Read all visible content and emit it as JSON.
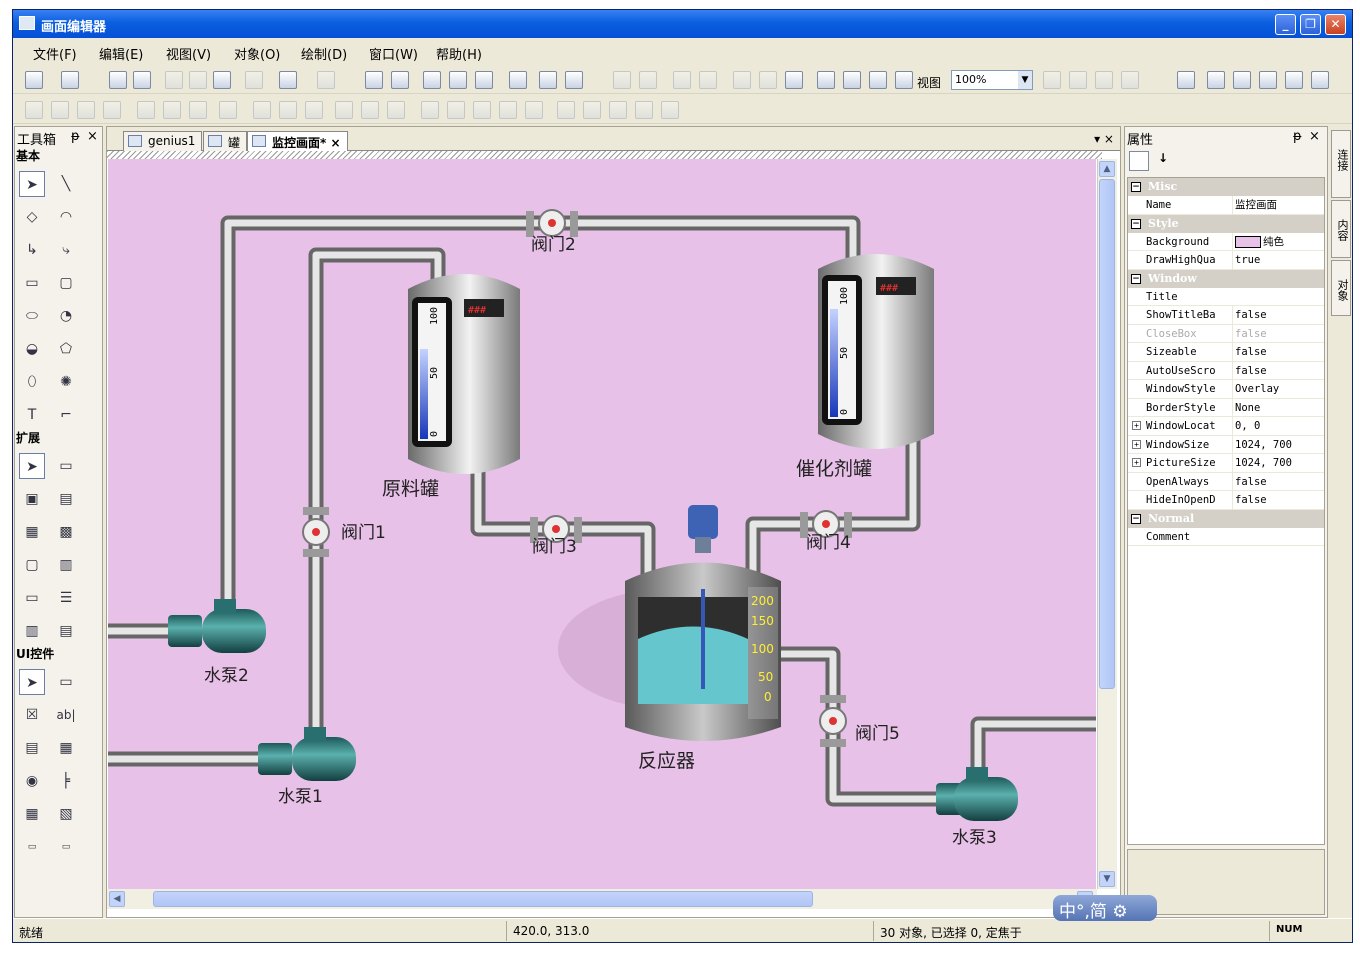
{
  "window": {
    "title": "画面编辑器"
  },
  "menu": [
    "文件(F)",
    "编辑(E)",
    "视图(V)",
    "对象(O)",
    "绘制(D)",
    "窗口(W)",
    "帮助(H)"
  ],
  "toolbar": {
    "view_label": "视图",
    "zoom": "100%"
  },
  "toolbox": {
    "title": "工具箱",
    "pin": "ᵽ",
    "close": "×",
    "sections": [
      "基本",
      "扩展",
      "UI控件"
    ],
    "ui_text_tool": "ab|"
  },
  "tabs": [
    {
      "label": "genius1",
      "active": false
    },
    {
      "label": "罐",
      "active": false
    },
    {
      "label": "监控画面*",
      "active": true
    }
  ],
  "tab_close": "×",
  "tab_menu": "▾ ×",
  "scada": {
    "valves": [
      "阀门1",
      "阀门2",
      "阀门3",
      "阀门4",
      "阀门5"
    ],
    "pumps": [
      "水泵1",
      "水泵2",
      "水泵3"
    ],
    "tank_raw": "原料罐",
    "tank_catalyst": "催化剂罐",
    "reactor": "反应器",
    "tank_scale": [
      "100",
      "50",
      "0"
    ],
    "tank_digits": "###",
    "reactor_scale": [
      "200",
      "150",
      "100",
      "50",
      "0"
    ],
    "colors": {
      "canvas": "#e8c1e8",
      "pipe": "#bfbfbf",
      "pump": "#2a7a7a",
      "gauge": "#2b4fc8"
    }
  },
  "properties": {
    "title": "属性",
    "pin": "ᵽ",
    "close": "×",
    "categories": [
      {
        "name": "Misc",
        "rows": [
          {
            "name": "Name",
            "value": "监控画面"
          }
        ]
      },
      {
        "name": "Style",
        "rows": [
          {
            "name": "Background",
            "value": "纯色",
            "swatch": "#e8c1e8"
          },
          {
            "name": "DrawHighQua",
            "value": "true"
          }
        ]
      },
      {
        "name": "Window",
        "rows": [
          {
            "name": "Title",
            "value": ""
          },
          {
            "name": "ShowTitleBa",
            "value": "false"
          },
          {
            "name": "CloseBox",
            "value": "false",
            "disabled": true
          },
          {
            "name": "Sizeable",
            "value": "false"
          },
          {
            "name": "AutoUseScro",
            "value": "false"
          },
          {
            "name": "WindowStyle",
            "value": "Overlay"
          },
          {
            "name": "BorderStyle",
            "value": "None"
          },
          {
            "name": "WindowLocat",
            "value": "0,  0",
            "expand": true
          },
          {
            "name": "WindowSize",
            "value": "1024,  700",
            "expand": true
          },
          {
            "name": "PictureSize",
            "value": "1024,  700",
            "expand": true
          },
          {
            "name": "OpenAlways",
            "value": "false"
          },
          {
            "name": "HideInOpenD",
            "value": "false"
          }
        ]
      },
      {
        "name": "Normal",
        "rows": [
          {
            "name": "Comment",
            "value": ""
          }
        ]
      }
    ]
  },
  "side_tabs": [
    "连接",
    "内容",
    "对象"
  ],
  "status": {
    "ready": "就绪",
    "coords": "420.0,  313.0",
    "objects": "30 对象, 已选择 0, 定焦于",
    "num": "NUM"
  },
  "ime": {
    "label": "中°,简"
  }
}
